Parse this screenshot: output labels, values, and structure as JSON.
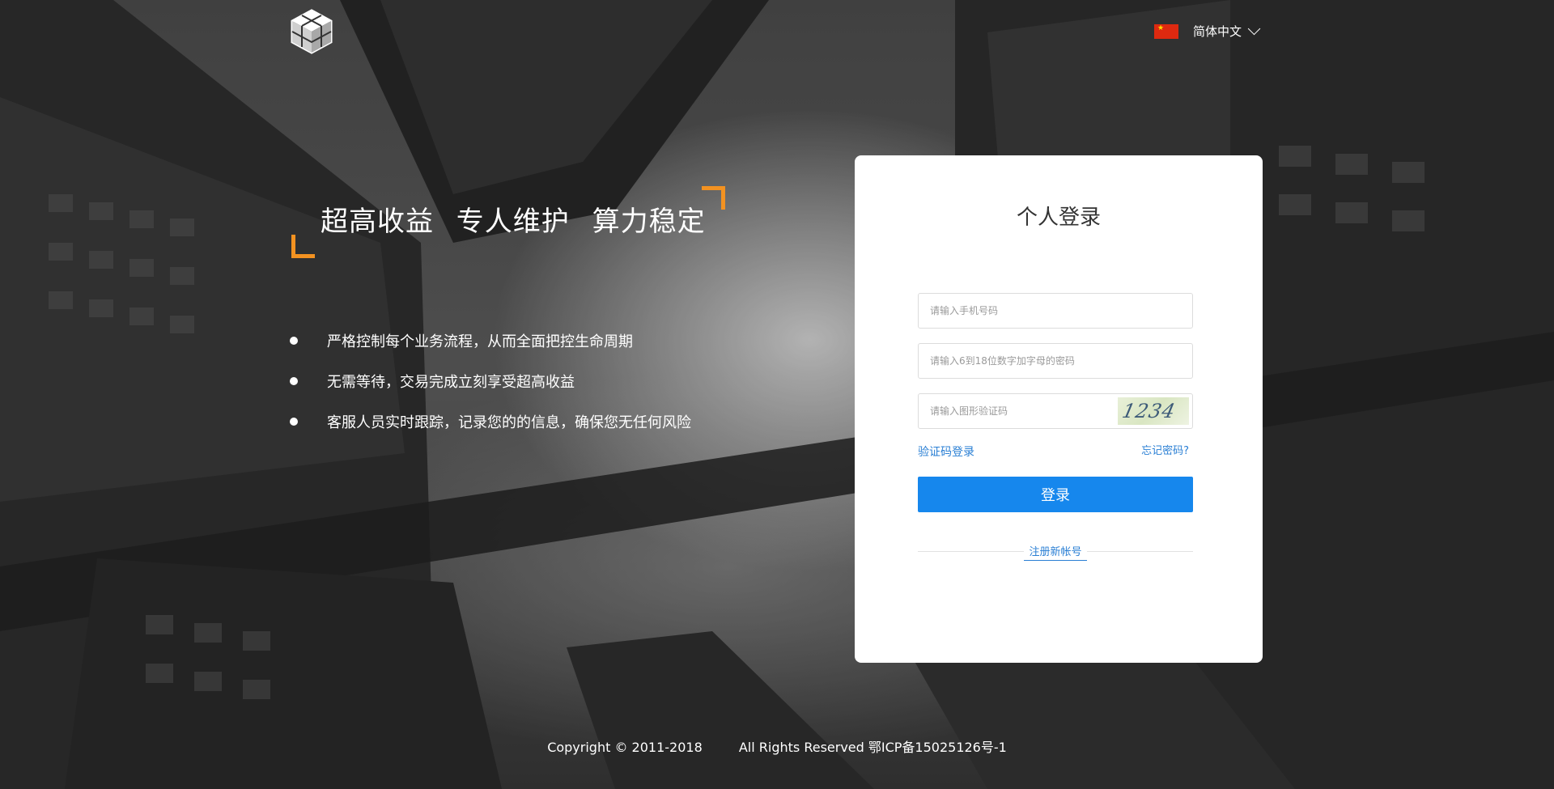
{
  "header": {
    "logo_icon": "cube-logo-icon",
    "language": {
      "flag_icon": "china-flag-icon",
      "label": "简体中文",
      "chevron_icon": "chevron-down-icon"
    }
  },
  "hero": {
    "title": "超高收益 专人维护 算力稳定",
    "accent_color": "#f39221",
    "bullets": [
      "严格控制每个业务流程，从而全面把控生命周期",
      "无需等待，交易完成立刻享受超高收益",
      "客服人员实时跟踪，记录您的的信息，确保您无任何风险"
    ]
  },
  "login": {
    "title": "个人登录",
    "phone": {
      "placeholder": "请输入手机号码",
      "value": ""
    },
    "password": {
      "placeholder": "请输入6到18位数字加字母的密码",
      "value": ""
    },
    "captcha": {
      "placeholder": "请输入图形验证码",
      "value": "",
      "image_text": "1234"
    },
    "sms_login_link": "验证码登录",
    "forgot_link": "忘记密码?",
    "submit_label": "登录",
    "register_link": "注册新帐号",
    "primary_color": "#1687ed",
    "link_color": "#2a7fd4"
  },
  "footer": {
    "copyright": "Copyright © 2011-2018",
    "rights": "All Rights Reserved 鄂ICP备15025126号-1"
  }
}
